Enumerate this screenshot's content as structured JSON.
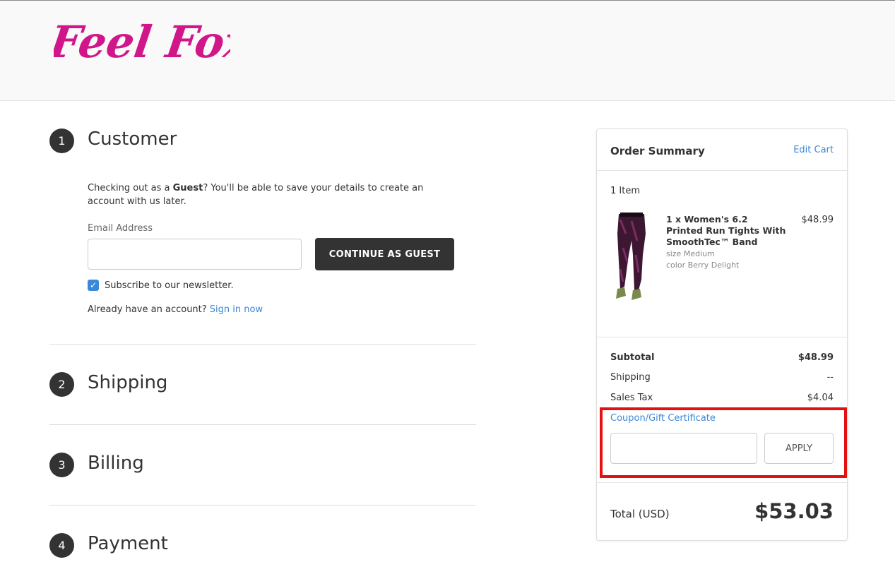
{
  "header": {
    "logo_text": "Feel Foxy",
    "logo_color": "#d1168a"
  },
  "steps": [
    {
      "number": "1",
      "title": "Customer"
    },
    {
      "number": "2",
      "title": "Shipping"
    },
    {
      "number": "3",
      "title": "Billing"
    },
    {
      "number": "4",
      "title": "Payment"
    }
  ],
  "customer": {
    "guest_prefix": "Checking out as a ",
    "guest_bold": "Guest",
    "guest_suffix": "? You'll be able to save your details to create an account with us later.",
    "email_label": "Email Address",
    "email_value": "",
    "continue_button": "CONTINUE AS GUEST",
    "newsletter_label": "Subscribe to our newsletter.",
    "newsletter_checked": true,
    "account_prompt": "Already have an account? ",
    "signin_link": "Sign in now"
  },
  "summary": {
    "title": "Order Summary",
    "edit_cart": "Edit Cart",
    "item_count": "1 Item",
    "item": {
      "name": "1 x Women's 6.2 Printed Run Tights With SmoothTec™ Band",
      "size": "size Medium",
      "color": "color Berry Delight",
      "price": "$48.99"
    },
    "subtotal_label": "Subtotal",
    "subtotal_value": "$48.99",
    "shipping_label": "Shipping",
    "shipping_value": "--",
    "tax_label": "Sales Tax",
    "tax_value": "$4.04",
    "coupon_link": "Coupon/Gift Certificate",
    "coupon_value": "",
    "apply_button": "APPLY",
    "total_label": "Total (USD)",
    "total_value": "$53.03"
  },
  "colors": {
    "accent": "#3b88d8",
    "dark": "#333333",
    "highlight": "#e51111"
  }
}
